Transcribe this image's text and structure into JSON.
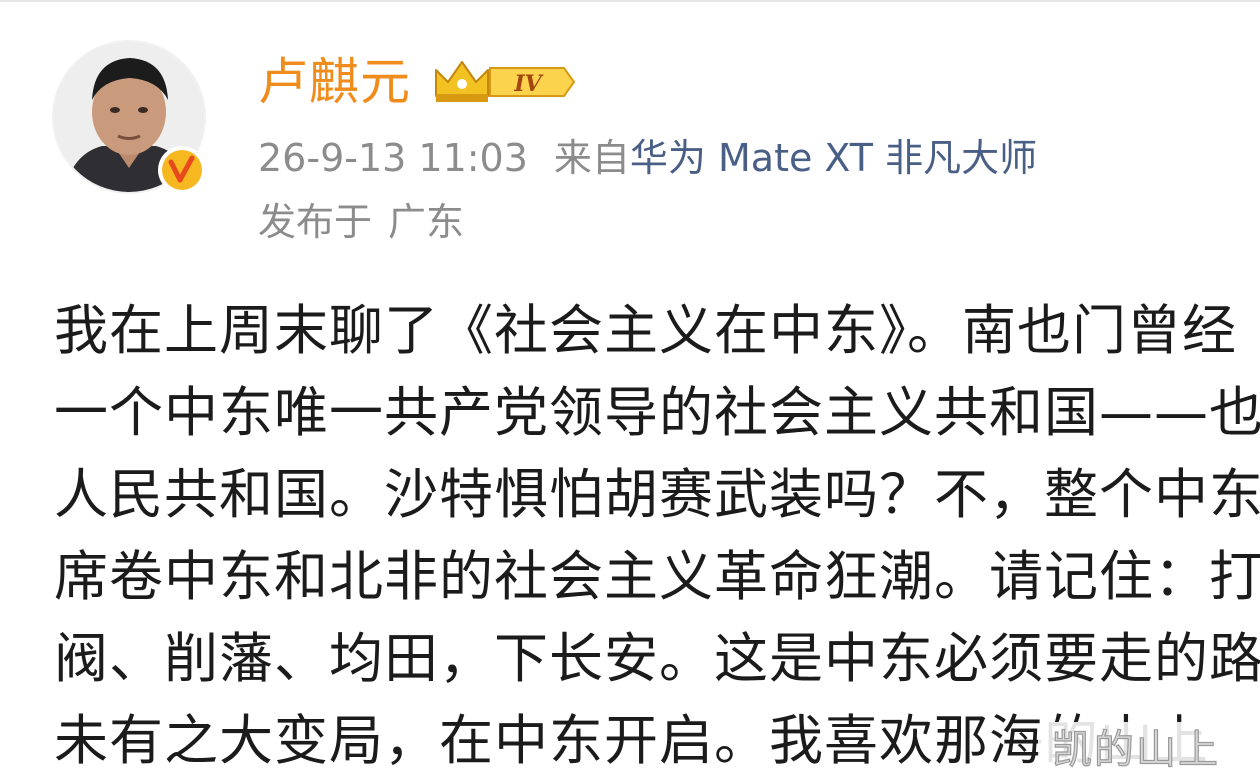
{
  "post": {
    "author": {
      "name": "卢麒元",
      "level_badge": "IV",
      "verified_icon": "v-verified-icon",
      "crown_icon": "crown-icon"
    },
    "meta": {
      "time": "26-9-13 11:03",
      "from_prefix": "来自",
      "device": "华为 Mate XT 非凡大师",
      "location_label": "发布于",
      "location": "广东"
    },
    "body_lines": [
      "我在上周末聊了《社会主义在中东》。南也门曾经",
      "一个中东唯一共产党领导的社会主义共和国——也",
      "人民共和国。沙特惧怕胡赛武装吗？不，整个中东",
      "席卷中东和北非的社会主义革命狂潮。请记住：打",
      "阀、削藩、均田，下长安。这是中东必须要走的路",
      "未有之大变局，在中东开启。我喜欢那海的山上"
    ]
  },
  "watermark": {
    "text": "凯的山上"
  },
  "colors": {
    "name": "#f08c1c",
    "meta": "#8c8c8c",
    "device_link": "#4a5f86",
    "body": "#1b1b1b",
    "badge_gold": "#f5b820"
  }
}
